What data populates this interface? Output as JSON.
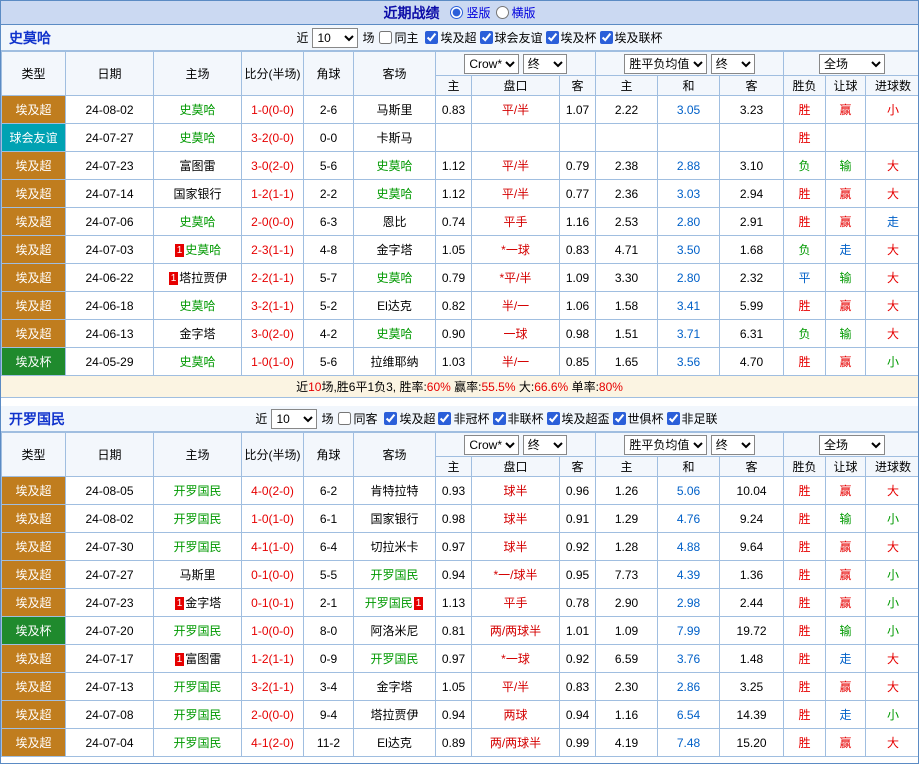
{
  "top_bar": {
    "title": "近期战绩",
    "vertical": "竖版",
    "horizontal": "横版"
  },
  "table_header": {
    "static_cols": [
      "类型",
      "日期",
      "主场",
      "比分(半场)",
      "角球",
      "客场"
    ],
    "ah_company": "Crow*",
    "ah_stage": "终",
    "ah_cols": [
      "主",
      "盘口",
      "客"
    ],
    "eu_company": "胜平负均值",
    "eu_stage": "终",
    "eu_cols": [
      "主",
      "和",
      "客"
    ],
    "scope": "全场",
    "result_cols": [
      "胜负",
      "让球",
      "进球数"
    ]
  },
  "colors": {
    "red": "#E60000",
    "green": "#009900",
    "blue": "#0060C8",
    "black": "#000000",
    "score": "#E60000",
    "handicap": "#D40000",
    "draw": "#0060C8",
    "team_green": "#009900"
  },
  "league_colors": {
    "埃及超": "#C07D1E",
    "球会友谊": "#00A2B3",
    "埃及杯": "#1F8A2D"
  },
  "sections": [
    {
      "team": "史莫哈",
      "filter": {
        "near": "近",
        "count": "10",
        "games": "场",
        "same_label": "同主",
        "leagues": [
          "埃及超",
          "球会友谊",
          "埃及杯",
          "埃及联杯"
        ]
      },
      "rows": [
        {
          "lg": "埃及超",
          "date": "24-08-02",
          "home": [
            "史莫哈",
            "g",
            0
          ],
          "score": "1-0(0-0)",
          "cn": "2-6",
          "away": [
            "马斯里",
            "k",
            0
          ],
          "ah": [
            "0.83",
            "平/半",
            "1.07"
          ],
          "eu": [
            "2.22",
            "3.05",
            "3.23"
          ],
          "rs": [
            [
              "胜",
              "red"
            ],
            [
              "赢",
              "red"
            ],
            [
              "小",
              "red"
            ]
          ]
        },
        {
          "lg": "球会友谊",
          "date": "24-07-27",
          "home": [
            "史莫哈",
            "g",
            0
          ],
          "score": "3-2(0-0)",
          "cn": "0-0",
          "away": [
            "卡斯马",
            "k",
            0
          ],
          "ah": [
            "",
            "",
            ""
          ],
          "eu": [
            "",
            "",
            ""
          ],
          "rs": [
            [
              "胜",
              "red"
            ],
            [
              "",
              ""
            ],
            [
              "",
              ""
            ]
          ]
        },
        {
          "lg": "埃及超",
          "date": "24-07-23",
          "home": [
            "富图雷",
            "k",
            0
          ],
          "score": "3-0(2-0)",
          "cn": "5-6",
          "away": [
            "史莫哈",
            "g",
            0
          ],
          "ah": [
            "1.12",
            "平/半",
            "0.79"
          ],
          "eu": [
            "2.38",
            "2.88",
            "3.10"
          ],
          "rs": [
            [
              "负",
              "green"
            ],
            [
              "输",
              "green"
            ],
            [
              "大",
              "red"
            ]
          ]
        },
        {
          "lg": "埃及超",
          "date": "24-07-14",
          "home": [
            "国家银行",
            "k",
            0
          ],
          "score": "1-2(1-1)",
          "cn": "2-2",
          "away": [
            "史莫哈",
            "g",
            0
          ],
          "ah": [
            "1.12",
            "平/半",
            "0.77"
          ],
          "eu": [
            "2.36",
            "3.03",
            "2.94"
          ],
          "rs": [
            [
              "胜",
              "red"
            ],
            [
              "赢",
              "red"
            ],
            [
              "大",
              "red"
            ]
          ]
        },
        {
          "lg": "埃及超",
          "date": "24-07-06",
          "home": [
            "史莫哈",
            "g",
            0
          ],
          "score": "2-0(0-0)",
          "cn": "6-3",
          "away": [
            "恩比",
            "k",
            0
          ],
          "ah": [
            "0.74",
            "平手",
            "1.16"
          ],
          "eu": [
            "2.53",
            "2.80",
            "2.91"
          ],
          "rs": [
            [
              "胜",
              "red"
            ],
            [
              "赢",
              "red"
            ],
            [
              "走",
              "blue"
            ]
          ]
        },
        {
          "lg": "埃及超",
          "date": "24-07-03",
          "home": [
            "史莫哈",
            "g",
            1
          ],
          "score": "2-3(1-1)",
          "cn": "4-8",
          "away": [
            "金字塔",
            "k",
            0
          ],
          "ah": [
            "1.05",
            "*一球",
            "0.83"
          ],
          "eu": [
            "4.71",
            "3.50",
            "1.68"
          ],
          "rs": [
            [
              "负",
              "green"
            ],
            [
              "走",
              "blue"
            ],
            [
              "大",
              "red"
            ]
          ]
        },
        {
          "lg": "埃及超",
          "date": "24-06-22",
          "home": [
            "塔拉贾伊",
            "k",
            1
          ],
          "score": "2-2(1-1)",
          "cn": "5-7",
          "away": [
            "史莫哈",
            "g",
            0
          ],
          "ah": [
            "0.79",
            "*平/半",
            "1.09"
          ],
          "eu": [
            "3.30",
            "2.80",
            "2.32"
          ],
          "rs": [
            [
              "平",
              "blue"
            ],
            [
              "输",
              "green"
            ],
            [
              "大",
              "red"
            ]
          ]
        },
        {
          "lg": "埃及超",
          "date": "24-06-18",
          "home": [
            "史莫哈",
            "g",
            0
          ],
          "score": "3-2(1-1)",
          "cn": "5-2",
          "away": [
            "El达克",
            "k",
            0
          ],
          "ah": [
            "0.82",
            "半/一",
            "1.06"
          ],
          "eu": [
            "1.58",
            "3.41",
            "5.99"
          ],
          "rs": [
            [
              "胜",
              "red"
            ],
            [
              "赢",
              "red"
            ],
            [
              "大",
              "red"
            ]
          ]
        },
        {
          "lg": "埃及超",
          "date": "24-06-13",
          "home": [
            "金字塔",
            "k",
            0
          ],
          "score": "3-0(2-0)",
          "cn": "4-2",
          "away": [
            "史莫哈",
            "g",
            0
          ],
          "ah": [
            "0.90",
            "一球",
            "0.98"
          ],
          "eu": [
            "1.51",
            "3.71",
            "6.31"
          ],
          "rs": [
            [
              "负",
              "green"
            ],
            [
              "输",
              "green"
            ],
            [
              "大",
              "red"
            ]
          ]
        },
        {
          "lg": "埃及杯",
          "date": "24-05-29",
          "home": [
            "史莫哈",
            "g",
            0
          ],
          "score": "1-0(1-0)",
          "cn": "5-6",
          "away": [
            "拉维耶纳",
            "k",
            0
          ],
          "ah": [
            "1.03",
            "半/一",
            "0.85"
          ],
          "eu": [
            "1.65",
            "3.56",
            "4.70"
          ],
          "rs": [
            [
              "胜",
              "red"
            ],
            [
              "赢",
              "red"
            ],
            [
              "小",
              "green"
            ]
          ]
        }
      ],
      "summary": [
        [
          "近",
          "black"
        ],
        [
          "10",
          "red"
        ],
        [
          "场,胜6平1负3, 胜率:",
          "black"
        ],
        [
          "60%",
          "red"
        ],
        [
          " 赢率:",
          "black"
        ],
        [
          "55.5%",
          "red"
        ],
        [
          " 大:",
          "black"
        ],
        [
          "66.6%",
          "red"
        ],
        [
          " 单率:",
          "black"
        ],
        [
          "80%",
          "red"
        ]
      ]
    },
    {
      "team": "开罗国民",
      "filter": {
        "near": "近",
        "count": "10",
        "games": "场",
        "same_label": "同客",
        "leagues": [
          "埃及超",
          "非冠杯",
          "非联杯",
          "埃及超盃",
          "世俱杯",
          "非足联"
        ]
      },
      "rows": [
        {
          "lg": "埃及超",
          "date": "24-08-05",
          "home": [
            "开罗国民",
            "g",
            0
          ],
          "score": "4-0(2-0)",
          "cn": "6-2",
          "away": [
            "肯特拉特",
            "k",
            0
          ],
          "ah": [
            "0.93",
            "球半",
            "0.96"
          ],
          "eu": [
            "1.26",
            "5.06",
            "10.04"
          ],
          "rs": [
            [
              "胜",
              "red"
            ],
            [
              "赢",
              "red"
            ],
            [
              "大",
              "red"
            ]
          ]
        },
        {
          "lg": "埃及超",
          "date": "24-08-02",
          "home": [
            "开罗国民",
            "g",
            0
          ],
          "score": "1-0(1-0)",
          "cn": "6-1",
          "away": [
            "国家银行",
            "k",
            0
          ],
          "ah": [
            "0.98",
            "球半",
            "0.91"
          ],
          "eu": [
            "1.29",
            "4.76",
            "9.24"
          ],
          "rs": [
            [
              "胜",
              "red"
            ],
            [
              "输",
              "green"
            ],
            [
              "小",
              "green"
            ]
          ]
        },
        {
          "lg": "埃及超",
          "date": "24-07-30",
          "home": [
            "开罗国民",
            "g",
            0
          ],
          "score": "4-1(1-0)",
          "cn": "6-4",
          "away": [
            "切拉米卡",
            "k",
            0
          ],
          "ah": [
            "0.97",
            "球半",
            "0.92"
          ],
          "eu": [
            "1.28",
            "4.88",
            "9.64"
          ],
          "rs": [
            [
              "胜",
              "red"
            ],
            [
              "赢",
              "red"
            ],
            [
              "大",
              "red"
            ]
          ]
        },
        {
          "lg": "埃及超",
          "date": "24-07-27",
          "home": [
            "马斯里",
            "k",
            0
          ],
          "score": "0-1(0-0)",
          "cn": "5-5",
          "away": [
            "开罗国民",
            "g",
            0
          ],
          "ah": [
            "0.94",
            "*一/球半",
            "0.95"
          ],
          "eu": [
            "7.73",
            "4.39",
            "1.36"
          ],
          "rs": [
            [
              "胜",
              "red"
            ],
            [
              "赢",
              "red"
            ],
            [
              "小",
              "green"
            ]
          ]
        },
        {
          "lg": "埃及超",
          "date": "24-07-23",
          "home": [
            "金字塔",
            "k",
            1
          ],
          "score": "0-1(0-1)",
          "cn": "2-1",
          "away": [
            "开罗国民",
            "g",
            1
          ],
          "ah": [
            "1.13",
            "平手",
            "0.78"
          ],
          "eu": [
            "2.90",
            "2.98",
            "2.44"
          ],
          "rs": [
            [
              "胜",
              "red"
            ],
            [
              "赢",
              "red"
            ],
            [
              "小",
              "green"
            ]
          ]
        },
        {
          "lg": "埃及杯",
          "date": "24-07-20",
          "home": [
            "开罗国民",
            "g",
            0
          ],
          "score": "1-0(0-0)",
          "cn": "8-0",
          "away": [
            "阿洛米尼",
            "k",
            0
          ],
          "ah": [
            "0.81",
            "两/两球半",
            "1.01"
          ],
          "eu": [
            "1.09",
            "7.99",
            "19.72"
          ],
          "rs": [
            [
              "胜",
              "red"
            ],
            [
              "输",
              "green"
            ],
            [
              "小",
              "green"
            ]
          ]
        },
        {
          "lg": "埃及超",
          "date": "24-07-17",
          "home": [
            "富图雷",
            "k",
            1
          ],
          "score": "1-2(1-1)",
          "cn": "0-9",
          "away": [
            "开罗国民",
            "g",
            0
          ],
          "ah": [
            "0.97",
            "*一球",
            "0.92"
          ],
          "eu": [
            "6.59",
            "3.76",
            "1.48"
          ],
          "rs": [
            [
              "胜",
              "red"
            ],
            [
              "走",
              "blue"
            ],
            [
              "大",
              "red"
            ]
          ]
        },
        {
          "lg": "埃及超",
          "date": "24-07-13",
          "home": [
            "开罗国民",
            "g",
            0
          ],
          "score": "3-2(1-1)",
          "cn": "3-4",
          "away": [
            "金字塔",
            "k",
            0
          ],
          "ah": [
            "1.05",
            "平/半",
            "0.83"
          ],
          "eu": [
            "2.30",
            "2.86",
            "3.25"
          ],
          "rs": [
            [
              "胜",
              "red"
            ],
            [
              "赢",
              "red"
            ],
            [
              "大",
              "red"
            ]
          ]
        },
        {
          "lg": "埃及超",
          "date": "24-07-08",
          "home": [
            "开罗国民",
            "g",
            0
          ],
          "score": "2-0(0-0)",
          "cn": "9-4",
          "away": [
            "塔拉贾伊",
            "k",
            0
          ],
          "ah": [
            "0.94",
            "两球",
            "0.94"
          ],
          "eu": [
            "1.16",
            "6.54",
            "14.39"
          ],
          "rs": [
            [
              "胜",
              "red"
            ],
            [
              "走",
              "blue"
            ],
            [
              "小",
              "green"
            ]
          ]
        },
        {
          "lg": "埃及超",
          "date": "24-07-04",
          "home": [
            "开罗国民",
            "g",
            0
          ],
          "score": "4-1(2-0)",
          "cn": "11-2",
          "away": [
            "El达克",
            "k",
            0
          ],
          "ah": [
            "0.89",
            "两/两球半",
            "0.99"
          ],
          "eu": [
            "4.19",
            "7.48",
            "15.20"
          ],
          "rs": [
            [
              "胜",
              "red"
            ],
            [
              "赢",
              "red"
            ],
            [
              "大",
              "red"
            ]
          ]
        }
      ]
    }
  ]
}
